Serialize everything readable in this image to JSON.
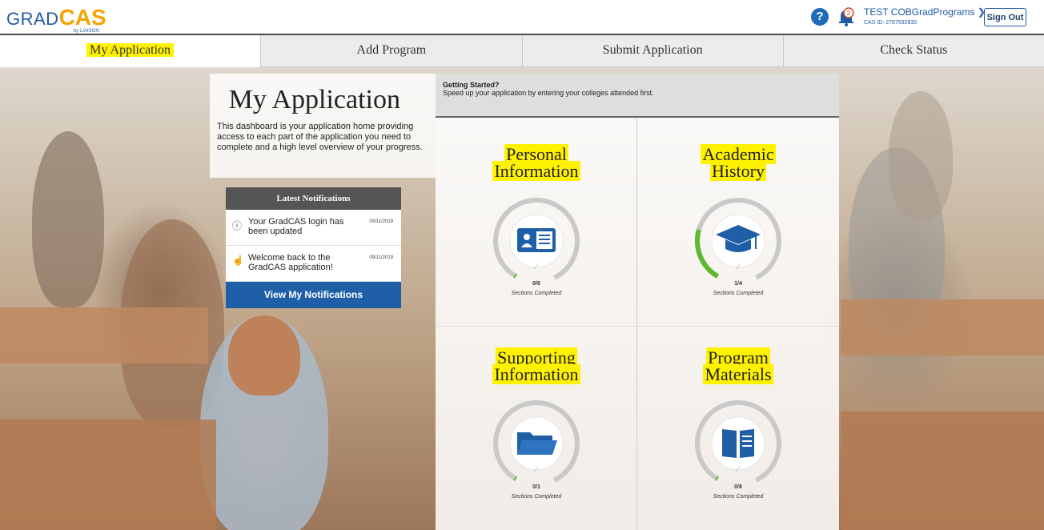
{
  "header": {
    "logo_grad": "GRAD",
    "logo_cas": "CAS",
    "logo_by": "by LIAISON",
    "help_glyph": "?",
    "notification_count": "2",
    "user_name": "TEST COBGradPrograms ❯",
    "user_id": "CAS ID: 2787592830",
    "signout_label": "Sign Out"
  },
  "nav": {
    "tabs": [
      {
        "label": "My Application",
        "active": true
      },
      {
        "label": "Add Program",
        "active": false
      },
      {
        "label": "Submit Application",
        "active": false
      },
      {
        "label": "Check Status",
        "active": false
      }
    ]
  },
  "intro": {
    "title": "My Application",
    "description": "This dashboard is your application home providing access to each part of the application you need to complete and a high level overview of your progress."
  },
  "notifications": {
    "heading": "Latest Notifications",
    "items": [
      {
        "icon": "info-icon",
        "text": "Your GradCAS login has been updated",
        "date": "09/11/2019"
      },
      {
        "icon": "wave-icon",
        "text": "Welcome back to the GradCAS application!",
        "date": "09/11/2019"
      }
    ],
    "button_label": "View My Notifications"
  },
  "getting_started": {
    "title": "Getting Started?",
    "text": "Speed up your application by entering your colleges attended first."
  },
  "quadrants": [
    {
      "title_line1": "Personal",
      "title_line2": "Information",
      "count": "0/6",
      "completed": 0,
      "total": 6,
      "label": "Sections Completed",
      "icon": "id-card-icon"
    },
    {
      "title_line1": "Academic",
      "title_line2": "History",
      "count": "1/4",
      "completed": 1,
      "total": 4,
      "label": "Sections Completed",
      "icon": "graduation-cap-icon"
    },
    {
      "title_line1": "Supporting",
      "title_line2": "Information",
      "count": "0/1",
      "completed": 0,
      "total": 1,
      "label": "Sections Completed",
      "icon": "folder-icon"
    },
    {
      "title_line1": "Program",
      "title_line2": "Materials",
      "count": "0/8",
      "completed": 0,
      "total": 8,
      "label": "Sections Completed",
      "icon": "book-icon"
    }
  ],
  "colors": {
    "accent": "#1e5fa8",
    "highlight": "#fff200",
    "progress": "#5cb82f"
  }
}
